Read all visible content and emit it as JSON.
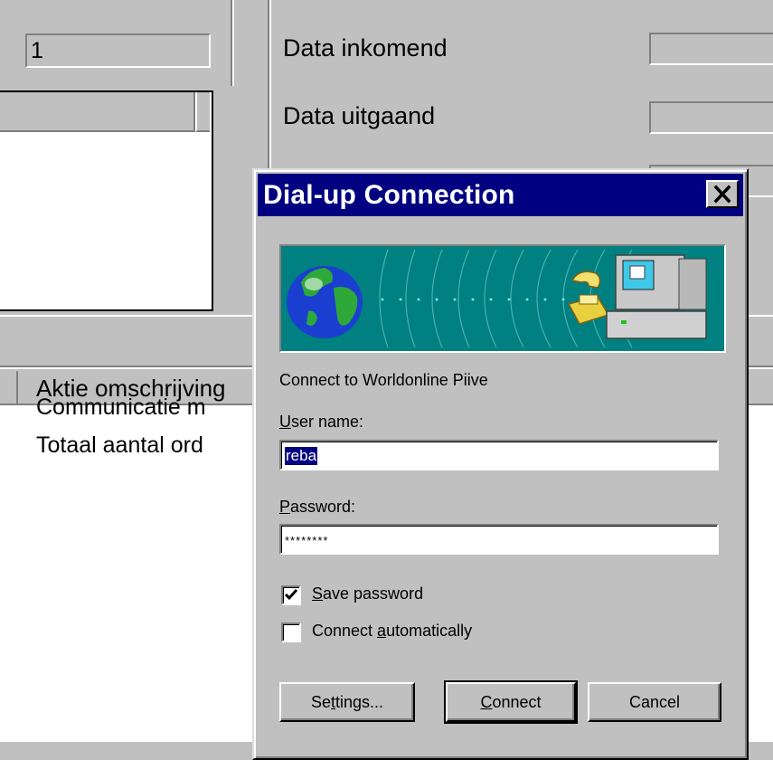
{
  "background": {
    "count_field_value": "1",
    "labels": {
      "data_in": "Data inkomend",
      "data_out": "Data uitgaand"
    },
    "action_header": "Aktie omschrijving",
    "log_lines": [
      "Communicatie m",
      "Totaal aantal ord"
    ]
  },
  "dialog": {
    "title": "Dial-up Connection",
    "connect_to": "Connect to Worldonline Piive",
    "username_label": {
      "mnemonic": "U",
      "rest": "ser name:"
    },
    "username_value": "reba",
    "password_label": {
      "mnemonic": "P",
      "rest": "assword:"
    },
    "password_value": "********",
    "save_password": {
      "mnemonic": "S",
      "rest": "ave password",
      "checked": true
    },
    "connect_auto": {
      "pre": "Connect ",
      "mnemonic": "a",
      "rest": "utomatically",
      "checked": false
    },
    "buttons": {
      "settings": {
        "pre": "Se",
        "mnemonic": "t",
        "rest": "tings..."
      },
      "connect": {
        "mnemonic": "C",
        "rest": "onnect"
      },
      "cancel": "Cancel"
    }
  },
  "colors": {
    "titlebar": "#000080",
    "banner": "#008080",
    "face": "#c0c0c0"
  }
}
